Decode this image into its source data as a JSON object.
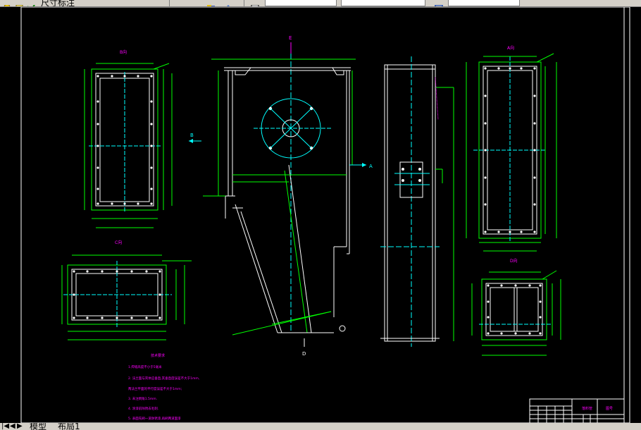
{
  "toolbar": {
    "layer_text": "尺寸标注",
    "colors": {
      "bg": "#d4d0c8"
    }
  },
  "drawing": {
    "background": "#000000",
    "colors": {
      "frame": "#ffffff",
      "geometry": "#00ff00",
      "dimension": "#ff00ff",
      "center": "#00ffff",
      "text": "#ff00ff"
    },
    "view_labels": {
      "b": "B向",
      "a": "A向",
      "c": "C向",
      "d": "D向"
    },
    "section_marks": {
      "top": "E",
      "left": "B",
      "right": "A",
      "bottom": "D"
    },
    "notes": {
      "title": "技术要求",
      "lines": [
        "1.焊缝高度不小于5毫米",
        "2. 法兰面与壳体应垂直,其垂直度误差不大于1mm,",
        "两法兰平面的平行度误差不大于1mm;",
        "3. 未注倒角1.5mm.",
        "4. 涂漆前除锈去毛刺.",
        "5. 表面先刷一道防锈漆,再刷两道面漆"
      ]
    },
    "title_block": {
      "name": "落料管",
      "code": "图号"
    }
  },
  "tabs": {
    "model": "模型",
    "layout": "布局1"
  }
}
